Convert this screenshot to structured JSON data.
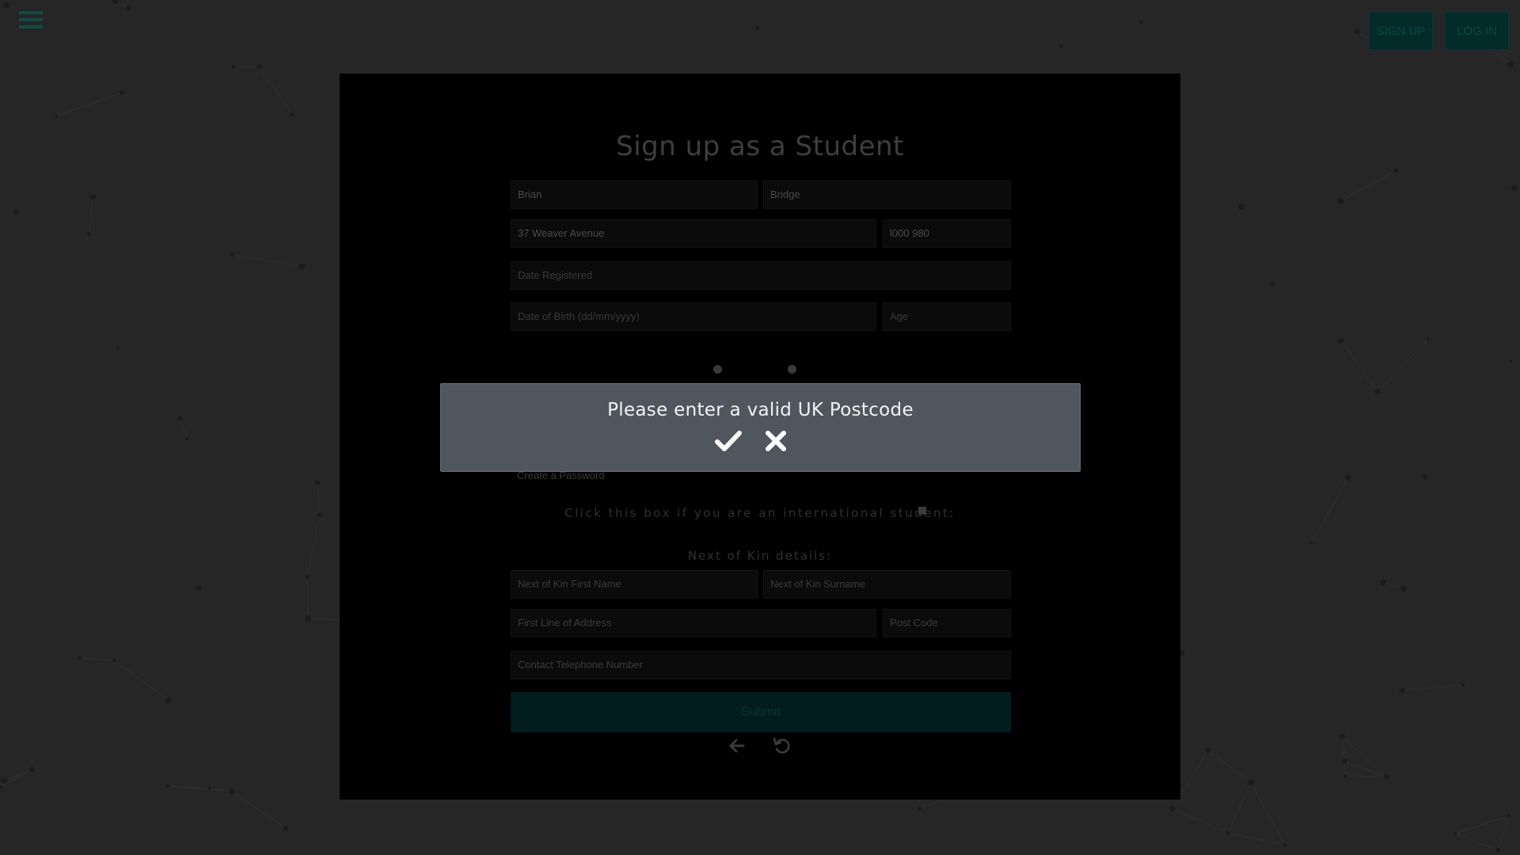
{
  "header": {
    "menu_icon": "hamburger-icon",
    "signup_label": "SIGN UP",
    "login_label": "LOG IN"
  },
  "form": {
    "title": "Sign up as a Student",
    "first_name": "Brian",
    "surname": "Bridge",
    "address": "37 Weaver Avenue",
    "postcode": "l000 980",
    "date_registered_placeholder": "Date Registered",
    "dob_placeholder": "Date of Birth (dd/mm/yyyy)",
    "age_placeholder": "Age",
    "password_placeholder": "Create a Password",
    "international_label": "Click this box if you are an international student:",
    "kin_heading": "Next of Kin details:",
    "kin_first_placeholder": "Next of Kin First Name",
    "kin_surname_placeholder": "Next of Kin Surname",
    "kin_address_placeholder": "First Line of Address",
    "kin_postcode_placeholder": "Post Code",
    "kin_phone_placeholder": "Contact Telephone Number",
    "submit_label": "Submit",
    "back_icon": "arrow-left-icon",
    "reset_icon": "undo-icon"
  },
  "modal": {
    "message": "Please enter a valid UK Postcode",
    "confirm_icon": "checkmark-icon",
    "cancel_icon": "close-icon"
  },
  "colors": {
    "accent": "#022b2a",
    "modal_bg": "#50565e",
    "page_bg": "#262626"
  }
}
